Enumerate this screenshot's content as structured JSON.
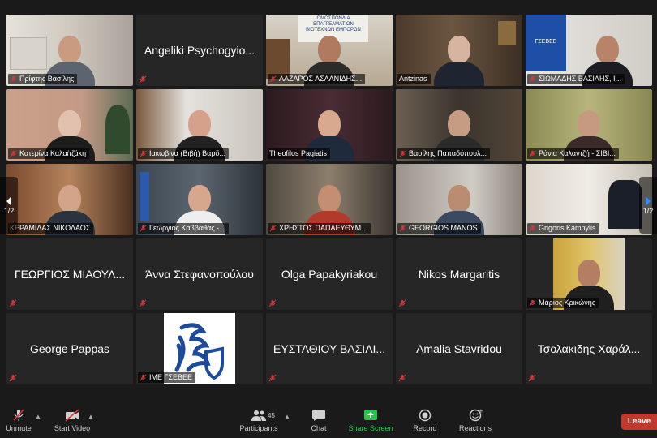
{
  "meeting": {
    "page_indicator_left": "1/2",
    "page_indicator_right": "1/2"
  },
  "tiles": [
    {
      "name": "Πρίφτης Βασίλης",
      "type": "video"
    },
    {
      "name": "Angeliki Psychogyio...",
      "type": "text"
    },
    {
      "name": "ΛΑΖΑΡΟΣ ΑΣΛΑΝΙΔΗΣ...",
      "type": "video",
      "banner": "ΟΜΟΣΠΟΝΔΙΑ ΕΠΑΓΓΕΛΜΑΤΙΩΝ ΒΙΟΤΕΧΝΩΝ ΕΜΠΟΡΩΝ"
    },
    {
      "name": "Antzinas",
      "type": "video"
    },
    {
      "name": "ΣΙΩΜΑΔΗΣ ΒΑΣΙΛΗΣ, Ι...",
      "type": "video",
      "logo_text": "ΓΣΕΒΕΕ"
    },
    {
      "name": "Κατερίνα Καλαϊτζάκη",
      "type": "video"
    },
    {
      "name": "Ιακωβίνα (Βιβή) Βαρδ...",
      "type": "video"
    },
    {
      "name": "Theofilos Pagiatis",
      "type": "video",
      "active": true
    },
    {
      "name": "Βασίλης Παπαδόπουλ...",
      "type": "video"
    },
    {
      "name": "Ράνια Καλαντζή - ΣΙΒΙ...",
      "type": "video"
    },
    {
      "name": "ΚΕΡΑΜΙΔΑΣ ΝΙΚΟΛΑΟΣ",
      "type": "video"
    },
    {
      "name": "Γεώργιος Καββαθάς -...",
      "type": "video"
    },
    {
      "name": "ΧΡΗΣΤΟΣ ΠΑΠΑΕΥΘΥΜ...",
      "type": "video"
    },
    {
      "name": "GEORGIOS MANOS",
      "type": "video"
    },
    {
      "name": "Grigoris Kampylis",
      "type": "video"
    },
    {
      "name": "ΓΕΩΡΓΙΟΣ ΜΙΑΟΥΛ...",
      "type": "text"
    },
    {
      "name": "Άννα Στεφανοπούλου",
      "type": "text"
    },
    {
      "name": "Olga Papakyriakou",
      "type": "text"
    },
    {
      "name": "Nikos Margaritis",
      "type": "text"
    },
    {
      "name": "Μάριος Κρικώνης",
      "type": "video"
    },
    {
      "name": "George Pappas",
      "type": "text"
    },
    {
      "name": "ΙΜΕ ΓΣΕΒΕΕ",
      "type": "logo"
    },
    {
      "name": "ΕΥΣΤΑΘΙΟΥ ΒΑΣΙΛΙ...",
      "type": "text"
    },
    {
      "name": "Amalia Stavridou",
      "type": "text"
    },
    {
      "name": "Τσολακιδης Χαράλ...",
      "type": "text"
    }
  ],
  "toolbar": {
    "unmute": "Unmute",
    "start_video": "Start Video",
    "participants": "Participants",
    "participants_count": "45",
    "chat": "Chat",
    "share_screen": "Share Screen",
    "record": "Record",
    "reactions": "Reactions",
    "leave": "Leave"
  },
  "colors": {
    "background": "#1a1a1a",
    "tile": "#262626",
    "active_border": "#d9e36a",
    "share_green": "#27c24c",
    "leave_red": "#c0392b",
    "muted_red": "#e0343a"
  }
}
